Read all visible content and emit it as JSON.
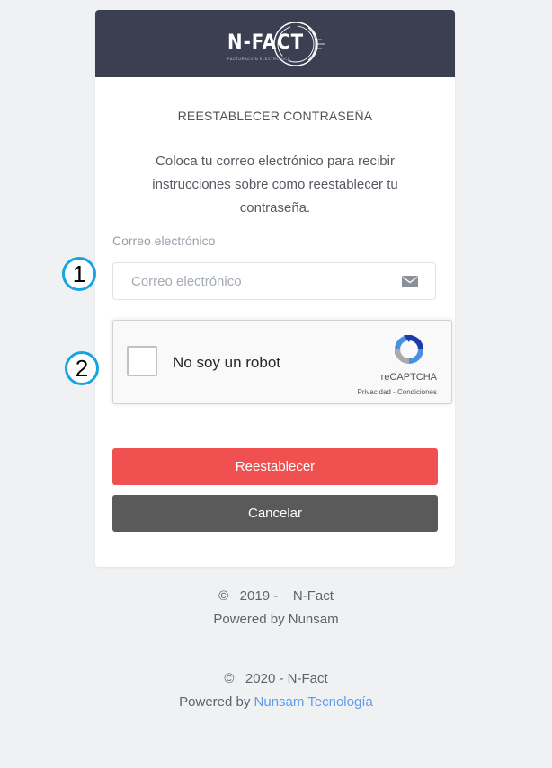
{
  "brand": {
    "logo_text": "N-FACT",
    "logo_subtext": "FACTURACION ELECTRONICA"
  },
  "form": {
    "title": "REESTABLECER CONTRASEÑA",
    "description": "Coloca tu correo electrónico para recibir instrucciones sobre como reestablecer tu contraseña.",
    "email_label": "Correo electrónico",
    "email_placeholder": "Correo electrónico",
    "email_value": "",
    "email_icon": "envelope-icon"
  },
  "recaptcha": {
    "label": "No soy un robot",
    "brand": "reCAPTCHA",
    "privacy": "Privacidad",
    "separator": " - ",
    "terms": "Condiciones",
    "checked": false
  },
  "buttons": {
    "reset_label": "Reestablecer",
    "cancel_label": "Cancelar"
  },
  "footer1": {
    "copyright": "©   2019 -    N-Fact",
    "powered": "Powered by Nunsam"
  },
  "footer2": {
    "copyright": "©   2020 - N-Fact",
    "powered_prefix": "Powered by ",
    "powered_link": "Nunsam Tecnología"
  },
  "annotations": {
    "one": "1",
    "two": "2"
  },
  "colors": {
    "header_bg": "#3a3f51",
    "reset_button": "#f05050",
    "cancel_button": "#5a5a5a",
    "link": "#5d9cec",
    "annotation_ring": "#17a4e0"
  }
}
